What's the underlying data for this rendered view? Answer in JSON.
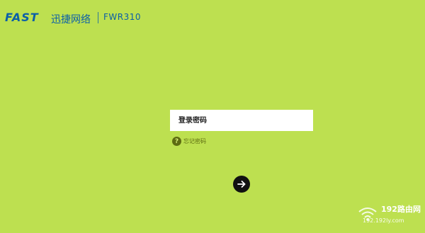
{
  "header": {
    "brand": "FAST",
    "brand_cn": "迅捷网络",
    "model": "FWR310"
  },
  "login": {
    "password_placeholder": "登录密码",
    "password_value": "",
    "forgot_label": "忘记密码",
    "help_icon_glyph": "?"
  },
  "watermark": {
    "text": "192路由网",
    "url": "192.192ly.com"
  },
  "colors": {
    "background": "#bde050",
    "brand": "#0b5fa8",
    "button": "#111111"
  },
  "icons": {
    "submit": "arrow-right-icon",
    "help": "question-icon",
    "watermark": "wifi-icon"
  }
}
